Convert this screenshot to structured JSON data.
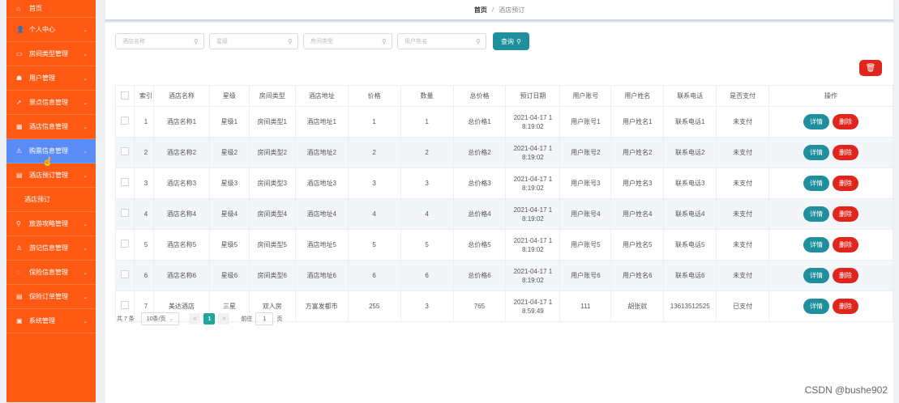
{
  "sidebar": {
    "items": [
      {
        "label": "首页",
        "icon": "home-icon",
        "glyph": "⌂"
      },
      {
        "label": "个人中心",
        "icon": "user-icon",
        "glyph": "👤"
      },
      {
        "label": "房间类型管理",
        "icon": "room-type-icon",
        "glyph": "▭"
      },
      {
        "label": "用户管理",
        "icon": "users-icon",
        "glyph": "☗"
      },
      {
        "label": "景点信息管理",
        "icon": "send-icon",
        "glyph": "➚"
      },
      {
        "label": "酒店信息管理",
        "icon": "grid-icon",
        "glyph": "▦"
      },
      {
        "label": "购票信息管理",
        "icon": "ticket-icon",
        "glyph": "⚠"
      },
      {
        "label": "酒店预订管理",
        "icon": "booking-icon",
        "glyph": "▤"
      },
      {
        "label": "酒店预订",
        "sub": true
      },
      {
        "label": "旅游攻略管理",
        "icon": "location-icon",
        "glyph": "⚲"
      },
      {
        "label": "游记信息管理",
        "icon": "person-icon",
        "glyph": "♙"
      },
      {
        "label": "保险信息管理",
        "icon": "circle-icon",
        "glyph": "◌"
      },
      {
        "label": "保险订单管理",
        "icon": "order-icon",
        "glyph": "▤"
      },
      {
        "label": "系统管理",
        "icon": "settings-icon",
        "glyph": "▣"
      }
    ],
    "active_index": 6,
    "chevron": "⌄"
  },
  "breadcrumb": {
    "home": "首页",
    "sep": "/",
    "current": "酒店预订"
  },
  "search": {
    "hotel_name_placeholder": "酒店名称",
    "star_placeholder": "星级",
    "room_type_placeholder": "房间类型",
    "username_placeholder": "用户姓名",
    "query_label": "查询",
    "search_glyph": "⚲"
  },
  "top_delete": {
    "glyph": "🗑"
  },
  "table": {
    "headers": [
      "索引",
      "酒店名称",
      "星级",
      "房间类型",
      "酒店地址",
      "价格",
      "数量",
      "总价格",
      "预订日期",
      "用户账号",
      "用户姓名",
      "联系电话",
      "是否支付",
      "操作"
    ],
    "rows": [
      [
        "1",
        "酒店名称1",
        "星级1",
        "房间类型1",
        "酒店地址1",
        "1",
        "1",
        "总价格1",
        "2021-04-17 1\n8:19:02",
        "用户账号1",
        "用户姓名1",
        "联系电话1",
        "未支付"
      ],
      [
        "2",
        "酒店名称2",
        "星级2",
        "房间类型2",
        "酒店地址2",
        "2",
        "2",
        "总价格2",
        "2021-04-17 1\n8:19:02",
        "用户账号2",
        "用户姓名2",
        "联系电话2",
        "未支付"
      ],
      [
        "3",
        "酒店名称3",
        "星级3",
        "房间类型3",
        "酒店地址3",
        "3",
        "3",
        "总价格3",
        "2021-04-17 1\n8:19:02",
        "用户账号3",
        "用户姓名3",
        "联系电话3",
        "未支付"
      ],
      [
        "4",
        "酒店名称4",
        "星级4",
        "房间类型4",
        "酒店地址4",
        "4",
        "4",
        "总价格4",
        "2021-04-17 1\n8:19:02",
        "用户账号4",
        "用户姓名4",
        "联系电话4",
        "未支付"
      ],
      [
        "5",
        "酒店名称5",
        "星级5",
        "房间类型5",
        "酒店地址5",
        "5",
        "5",
        "总价格5",
        "2021-04-17 1\n8:19:02",
        "用户账号5",
        "用户姓名5",
        "联系电话5",
        "未支付"
      ],
      [
        "6",
        "酒店名称6",
        "星级6",
        "房间类型6",
        "酒店地址6",
        "6",
        "6",
        "总价格6",
        "2021-04-17 1\n8:19:02",
        "用户账号6",
        "用户姓名6",
        "联系电话6",
        "未支付"
      ],
      [
        "7",
        "美达酒店",
        "三星",
        "双人房",
        "方富发都市",
        "255",
        "3",
        "765",
        "2021-04-17 1\n8:59:49",
        "111",
        "胡张就",
        "13613512525",
        "已支付"
      ]
    ],
    "detail_label": "详情",
    "delete_label": "删除"
  },
  "pagination": {
    "total": "共 7 条",
    "page_size": "10条/页",
    "prev": "<",
    "current": "1",
    "next": ">",
    "goto_prefix": "前往",
    "goto_value": "1",
    "goto_suffix": "页"
  },
  "watermark": "CSDN @bushe902",
  "colors": {
    "sidebar": "#ff5a14",
    "active": "#5b8cf5",
    "teal": "#1f8f9d",
    "red": "#e0261c"
  }
}
